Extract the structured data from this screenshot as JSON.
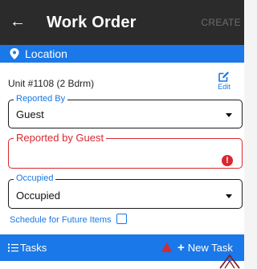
{
  "header": {
    "title": "Work Order",
    "create_label": "CREATE"
  },
  "location_section": {
    "label": "Location"
  },
  "unit": {
    "name": "Unit #1108 (2 Bdrm)",
    "edit_label": "Edit"
  },
  "form": {
    "reported_by": {
      "label": "Reported By",
      "value": "Guest"
    },
    "reported_by_guest": {
      "label": "Reported by Guest",
      "value": ""
    },
    "occupied": {
      "label": "Occupied",
      "value": "Occupied"
    },
    "schedule_label": "Schedule for Future Items",
    "schedule_checked": false
  },
  "tasks": {
    "label": "Tasks",
    "new_task_label": "New Task"
  },
  "colors": {
    "topbar": "#2b2b2b",
    "accent": "#1a78e8",
    "error": "#d9282f"
  }
}
